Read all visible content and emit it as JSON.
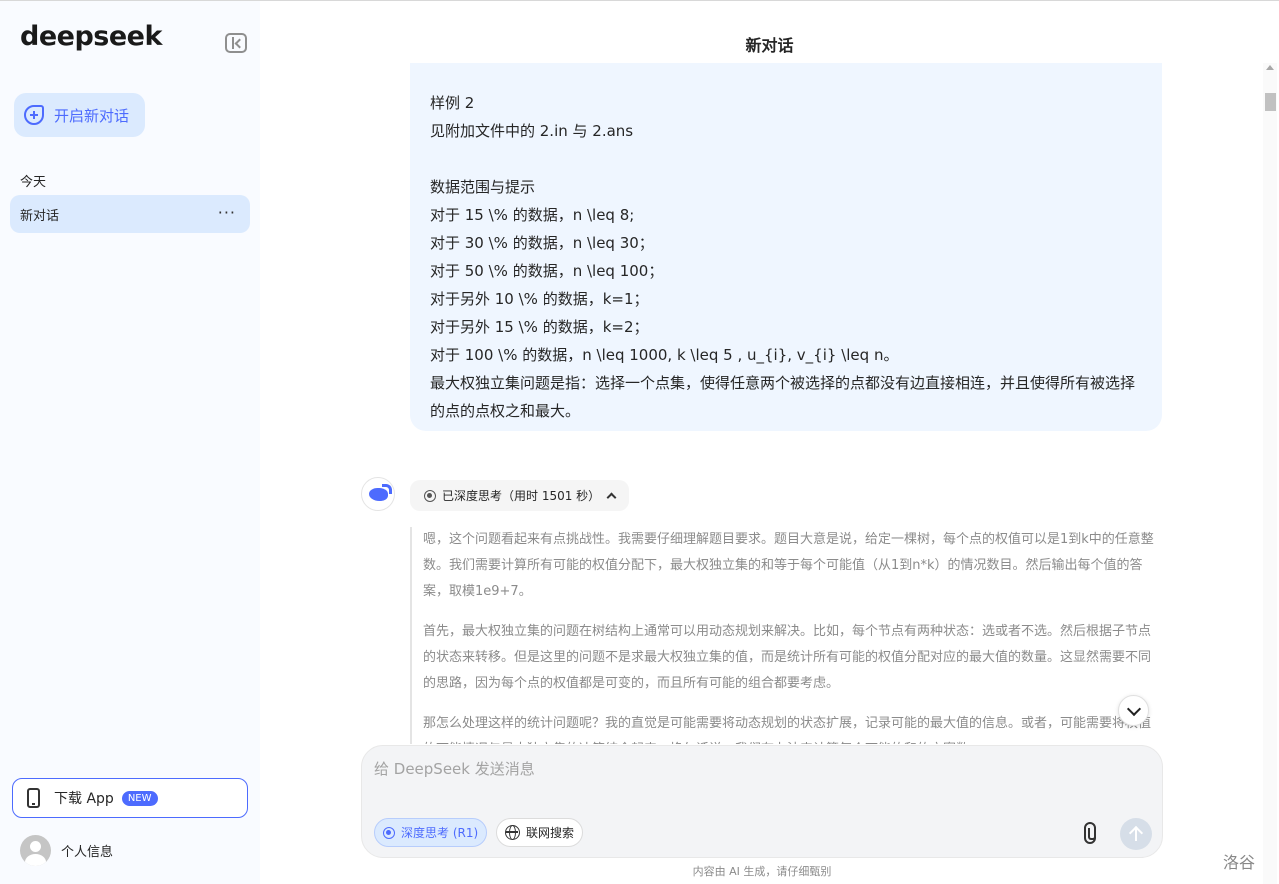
{
  "sidebar": {
    "logo": "deepseek",
    "new_chat_label": "开启新对话",
    "section_today": "今天",
    "history": [
      {
        "label": "新对话"
      }
    ],
    "more_label": "···",
    "download_label": "下载 App",
    "new_badge": "NEW",
    "profile_label": "个人信息"
  },
  "main": {
    "title": "新对话",
    "user_message_lines": [
      "样例 2",
      "见附加文件中的 2.in 与 2.ans",
      "",
      "数据范围与提示",
      "对于 15 \\% 的数据，n \\leq 8;",
      "对于 30 \\% 的数据，n \\leq 30；",
      "对于 50 \\% 的数据，n \\leq 100；",
      "对于另外 10 \\% 的数据，k=1；",
      "对于另外 15 \\% 的数据，k=2；",
      "对于 100 \\% 的数据，n \\leq 1000, k \\leq 5 , u_{i}, v_{i} \\leq n。",
      "最大权独立集问题是指：选择一个点集，使得任意两个被选择的点都没有边直接相连，并且使得所有被选择的点的点权之和最大。"
    ],
    "thinking_label": "已深度思考（用时 1501 秒）",
    "thinking_paragraphs": [
      "嗯，这个问题看起来有点挑战性。我需要仔细理解题目要求。题目大意是说，给定一棵树，每个点的权值可以是1到k中的任意整数。我们需要计算所有可能的权值分配下，最大权独立集的和等于每个可能值（从1到n*k）的情况数目。然后输出每个值的答案，取模1e9+7。",
      "首先，最大权独立集的问题在树结构上通常可以用动态规划来解决。比如，每个节点有两种状态：选或者不选。然后根据子节点的状态来转移。但是这里的问题不是求最大权独立集的值，而是统计所有可能的权值分配对应的最大值的数量。这显然需要不同的思路，因为每个点的权值都是可变的，而且所有可能的组合都要考虑。",
      "那怎么处理这样的统计问题呢？我的直觉是可能需要将动态规划的状态扩展，记录可能的最大值的信息。或者，可能需要将权值的可能情况与最大独立集的决策结合起来。换句话说，我们有办法来计算每个可能的和的方案数。"
    ]
  },
  "composer": {
    "placeholder": "给 DeepSeek 发送消息",
    "deep_think_label": "深度思考 (R1)",
    "web_search_label": "联网搜索"
  },
  "disclaimer": "内容由 AI 生成，请仔细甄别",
  "watermark": "洛谷",
  "colors": {
    "accent": "#4d6bfe",
    "sidebar_bg": "#f9fbff",
    "highlight_bg": "#dbeafe",
    "user_bubble_bg": "#eff6ff"
  }
}
